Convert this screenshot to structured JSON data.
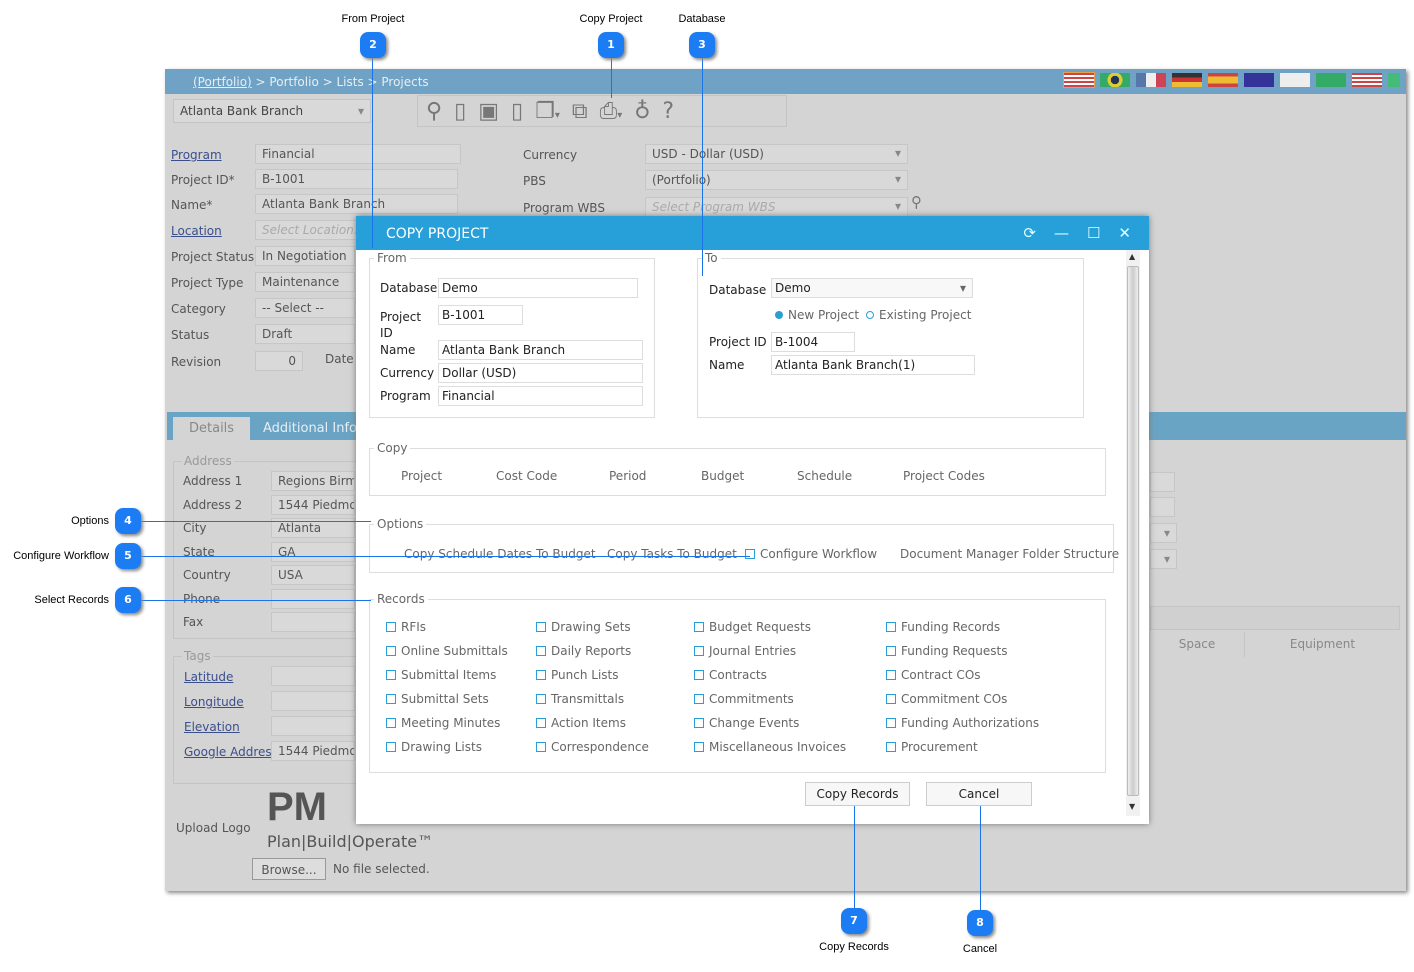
{
  "background": {
    "breadcrumb": {
      "root": "(Portfolio)",
      "rest": " > Portfolio > Lists > Projects"
    },
    "project_select": "Atlanta Bank Branch",
    "fields_left": [
      {
        "label": "Program",
        "value": "Financial",
        "link": true
      },
      {
        "label": "Project ID*",
        "value": "B-1001"
      },
      {
        "label": "Name*",
        "value": "Atlanta Bank Branch"
      },
      {
        "label": "Location",
        "placeholder": "Select Location...",
        "link": true
      },
      {
        "label": "Project Status",
        "value": "In Negotiation"
      },
      {
        "label": "Project Type",
        "value": "Maintenance"
      },
      {
        "label": "Category",
        "value": "-- Select --"
      },
      {
        "label": "Status",
        "value": "Draft"
      },
      {
        "label": "Revision",
        "value": "0"
      }
    ],
    "date_label": "Date",
    "fields_right": [
      {
        "label": "Currency",
        "value": "USD - Dollar (USD)"
      },
      {
        "label": "PBS",
        "value": "(Portfolio)"
      },
      {
        "label": "Program WBS",
        "placeholder": "Select Program WBS"
      }
    ],
    "tabs": [
      "Details",
      "Additional Info"
    ],
    "address_legend": "Address",
    "address": [
      {
        "label": "Address 1",
        "value": "Regions Birming"
      },
      {
        "label": "Address 2",
        "value": "1544 Piedmont"
      },
      {
        "label": "City",
        "value": "Atlanta"
      },
      {
        "label": "State",
        "value": "GA"
      },
      {
        "label": "Country",
        "value": "USA"
      },
      {
        "label": "Phone",
        "value": ""
      },
      {
        "label": "Fax",
        "value": ""
      }
    ],
    "tags_legend": "Tags",
    "tags": [
      {
        "label": "Latitude",
        "value": ""
      },
      {
        "label": "Longitude",
        "value": ""
      },
      {
        "label": "Elevation",
        "value": ""
      },
      {
        "label": "Google Address",
        "value": "1544 Piedmont"
      }
    ],
    "upload_logo": "Upload Logo",
    "logo_text": "PM",
    "logo_tagline": "Plan|Build|Operate™",
    "browse": "Browse...",
    "no_file": "No file selected.",
    "table_cols": [
      "Space",
      "Equipment"
    ]
  },
  "dialog": {
    "title": "COPY PROJECT",
    "from": {
      "legend": "From",
      "fields": [
        {
          "label": "Database",
          "value": "Demo"
        },
        {
          "label": "Project ID",
          "value": "B-1001"
        },
        {
          "label": "Name",
          "value": "Atlanta Bank Branch"
        },
        {
          "label": "Currency",
          "value": "Dollar (USD)"
        },
        {
          "label": "Program",
          "value": "Financial"
        }
      ]
    },
    "to": {
      "legend": "To",
      "database_label": "Database",
      "database": "Demo",
      "radio_new": "New Project",
      "radio_existing": "Existing Project",
      "selected": "New Project",
      "project_id_label": "Project ID",
      "project_id": "B-1004",
      "name_label": "Name",
      "name": "Atlanta Bank Branch(1)"
    },
    "copy": {
      "legend": "Copy",
      "items": [
        "Project",
        "Cost Code",
        "Period",
        "Budget",
        "Schedule",
        "Project Codes"
      ]
    },
    "options": {
      "legend": "Options",
      "items": [
        "Copy Schedule Dates To Budget",
        "Copy Tasks To Budget",
        "Configure Workflow",
        "Document Manager Folder Structure"
      ]
    },
    "records": {
      "legend": "Records",
      "columns": [
        [
          "RFIs",
          "Online Submittals",
          "Submittal Items",
          "Submittal Sets",
          "Meeting Minutes",
          "Drawing Lists"
        ],
        [
          "Drawing Sets",
          "Daily Reports",
          "Punch Lists",
          "Transmittals",
          "Action Items",
          "Correspondence"
        ],
        [
          "Budget Requests",
          "Journal Entries",
          "Contracts",
          "Commitments",
          "Change Events",
          "Miscellaneous Invoices"
        ],
        [
          "Funding Records",
          "Funding Requests",
          "Contract COs",
          "Commitment COs",
          "Funding Authorizations",
          "Procurement"
        ]
      ]
    },
    "copy_records": "Copy Records",
    "cancel": "Cancel"
  },
  "callouts": [
    {
      "n": "1",
      "label": "Copy Project"
    },
    {
      "n": "2",
      "label": "From Project"
    },
    {
      "n": "3",
      "label": "Database"
    },
    {
      "n": "4",
      "label": "Options"
    },
    {
      "n": "5",
      "label": "Configure Workflow"
    },
    {
      "n": "6",
      "label": "Select Records"
    },
    {
      "n": "7",
      "label": "Copy Records"
    },
    {
      "n": "8",
      "label": "Cancel"
    }
  ],
  "colors": {
    "dialog_header": "#279fd9",
    "callout": "#1c7cf4",
    "checkbox": "#2a9fd6",
    "topbar": "#6fa2c4"
  }
}
